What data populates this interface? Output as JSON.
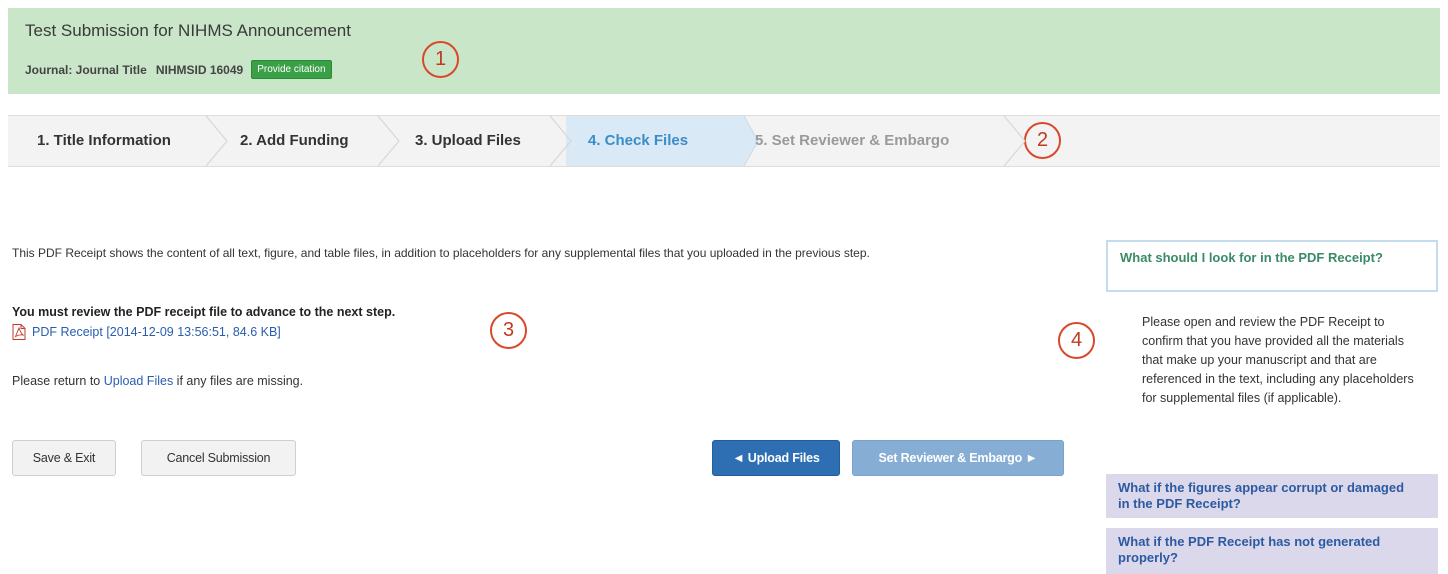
{
  "header": {
    "title": "Test Submission for NIHMS Announcement",
    "journal": "Journal: Journal Title",
    "nihmsid": "NIHMSID 16049",
    "citation_button": "Provide citation",
    "bg_color": "#c9e6c9"
  },
  "callouts": [
    "1",
    "2",
    "3",
    "4"
  ],
  "steps": [
    {
      "label": "1. Title Information",
      "state": "done"
    },
    {
      "label": "2. Add Funding",
      "state": "done"
    },
    {
      "label": "3. Upload Files",
      "state": "done"
    },
    {
      "label": "4. Check Files",
      "state": "active"
    },
    {
      "label": "5. Set Reviewer & Embargo",
      "state": "disabled"
    }
  ],
  "main": {
    "intro": "This PDF Receipt shows the content of all text, figure, and table files, in addition to placeholders for any supplemental files that you uploaded in the previous step.",
    "must_review": "You must review the PDF receipt file to advance to the next step.",
    "pdf_icon": "pdf-file-icon",
    "receipt_link": "PDF Receipt [2014-12-09 13:56:51, 84.6 KB]",
    "return_prefix": "Please return to ",
    "return_link": "Upload Files",
    "return_suffix": " if any files are missing."
  },
  "buttons": {
    "save_exit": "Save & Exit",
    "cancel": "Cancel Submission",
    "prev": "◄ Upload Files",
    "next": "Set Reviewer & Embargo ►"
  },
  "sidebar": {
    "open_question": "What should I look for in the PDF Receipt?",
    "open_answer": "Please open and review the PDF Receipt to confirm that you have provided all the materials that make up your manuscript and that are referenced in the text, including any placeholders for supplemental files (if applicable).",
    "items": [
      "What if the figures appear corrupt or damaged in the PDF Receipt?",
      "What if the PDF Receipt has not generated properly?"
    ]
  },
  "colors": {
    "accent": "#2e6fb3",
    "active_step": "#3b8dc7",
    "callout": "#d9482b",
    "faq_bg": "#dcd8ec"
  }
}
